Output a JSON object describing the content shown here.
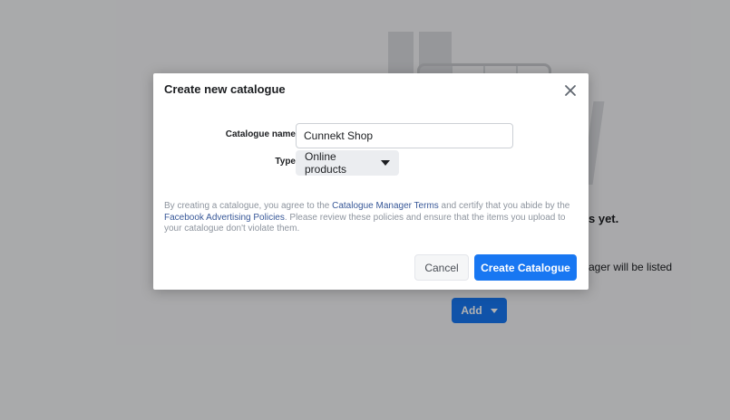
{
  "background": {
    "heading": "s yet.",
    "description": "ager will be listed",
    "add_label": "Add"
  },
  "dialog": {
    "title": "Create new catalogue",
    "catalogue_name_label": "Catalogue name",
    "catalogue_name_value": "Cunnekt Shop",
    "type_label": "Type",
    "type_value": "Online products",
    "disclaimer": {
      "part1": "By creating a catalogue, you agree to the ",
      "link1": "Catalogue Manager Terms",
      "part2": " and certify that you abide by the ",
      "link2": "Facebook Advertising Policies",
      "part3": ". Please review these policies and ensure that the items you upload to your catalogue don't violate them."
    },
    "cancel_label": "Cancel",
    "create_label": "Create Catalogue"
  },
  "colors": {
    "primary": "#1877f2",
    "link": "#385898",
    "muted_text": "#8d949e"
  },
  "icons": {
    "close": "close-icon",
    "dropdown": "caret-down-icon"
  }
}
